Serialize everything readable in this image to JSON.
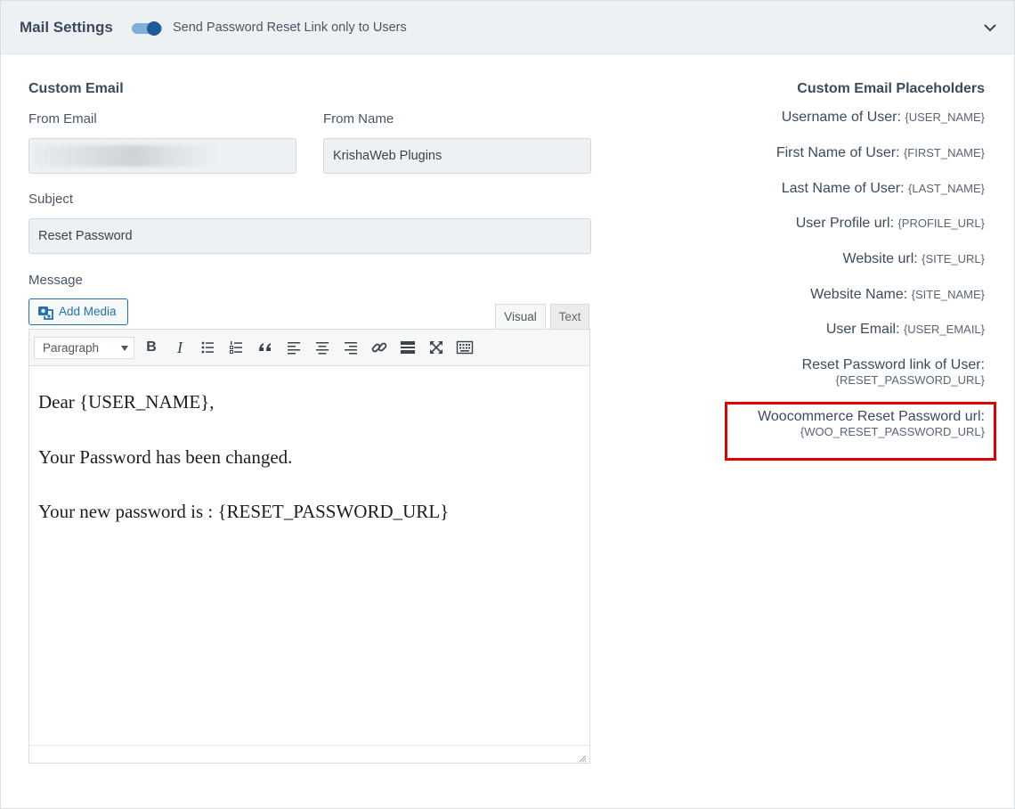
{
  "header": {
    "title": "Mail Settings",
    "toggle_label": "Send Password Reset Link only to Users",
    "toggle_on": true
  },
  "form": {
    "section_title": "Custom Email",
    "from_email_label": "From Email",
    "from_email_value": "",
    "from_name_label": "From Name",
    "from_name_value": "KrishaWeb Plugins",
    "subject_label": "Subject",
    "subject_value": "Reset Password",
    "message_label": "Message",
    "add_media_label": "Add Media"
  },
  "editor": {
    "tabs": [
      {
        "label": "Visual",
        "active": true
      },
      {
        "label": "Text",
        "active": false
      }
    ],
    "format_select": "Paragraph",
    "toolbar_icons": [
      "bold-icon",
      "italic-icon",
      "bullet-list-icon",
      "numbered-list-icon",
      "blockquote-icon",
      "align-left-icon",
      "align-center-icon",
      "align-right-icon",
      "link-icon",
      "read-more-icon",
      "fullscreen-icon",
      "toolbar-toggle-icon"
    ],
    "lines": [
      "Dear {USER_NAME},",
      "Your Password has been changed.",
      "Your new password is : {RESET_PASSWORD_URL}"
    ]
  },
  "placeholders": {
    "title": "Custom Email Placeholders",
    "items": [
      {
        "name": "Username of User:",
        "code": "{USER_NAME}"
      },
      {
        "name": "First Name of User:",
        "code": "{FIRST_NAME}"
      },
      {
        "name": "Last Name of User:",
        "code": "{LAST_NAME}"
      },
      {
        "name": "User Profile url:",
        "code": "{PROFILE_URL}"
      },
      {
        "name": "Website url:",
        "code": "{SITE_URL}"
      },
      {
        "name": "Website Name:",
        "code": "{SITE_NAME}"
      },
      {
        "name": "User Email:",
        "code": "{USER_EMAIL}"
      },
      {
        "name": "Reset Password link of User:",
        "code": "{RESET_PASSWORD_URL}"
      },
      {
        "name": "Woocommerce Reset Password url:",
        "code": "{WOO_RESET_PASSWORD_URL}"
      }
    ]
  },
  "colors": {
    "accent": "#2271b1",
    "toggle_knob": "#1f5a96",
    "highlight_border": "#e00000",
    "header_bg": "#eef1f4"
  }
}
